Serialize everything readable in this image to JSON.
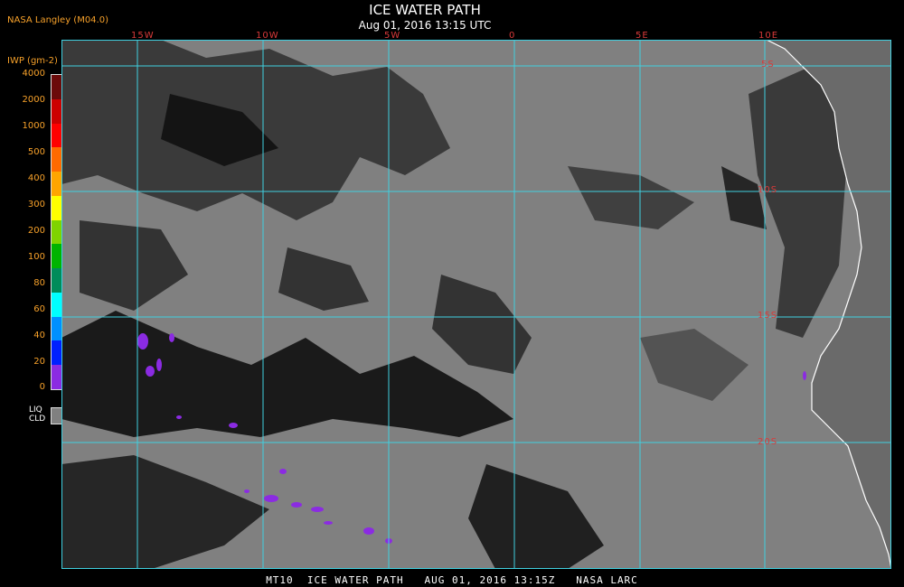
{
  "header": {
    "title": "ICE WATER PATH",
    "subtitle": "Aug 01, 2016 13:15 UTC",
    "source": "NASA Langley (M04.0)"
  },
  "legend": {
    "title": "IWP (gm-2)",
    "labels": [
      "4000",
      "2000",
      "1000",
      "500",
      "400",
      "300",
      "200",
      "100",
      "80",
      "60",
      "40",
      "20",
      "0"
    ],
    "colors": [
      "#6b0a0a",
      "#cc0000",
      "#ff0000",
      "#ff6a00",
      "#ffa500",
      "#ffff00",
      "#7fd400",
      "#00b400",
      "#008c5a",
      "#00ffff",
      "#0090ff",
      "#0020ff",
      "#8b2be2"
    ],
    "liq_label_1": "LIQ",
    "liq_label_2": "CLD",
    "liq_color": "#808080"
  },
  "map": {
    "grid_color": "#40d0e0",
    "lon_labels": [
      "15W",
      "10W",
      "5W",
      "0",
      "5E",
      "10E"
    ],
    "lat_labels": [
      "5S",
      "10S",
      "15S",
      "20S"
    ],
    "coast_color": "#ffffff"
  },
  "footer": {
    "text": "MT10  ICE WATER PATH   AUG 01, 2016 13:15Z   NASA LARC"
  }
}
